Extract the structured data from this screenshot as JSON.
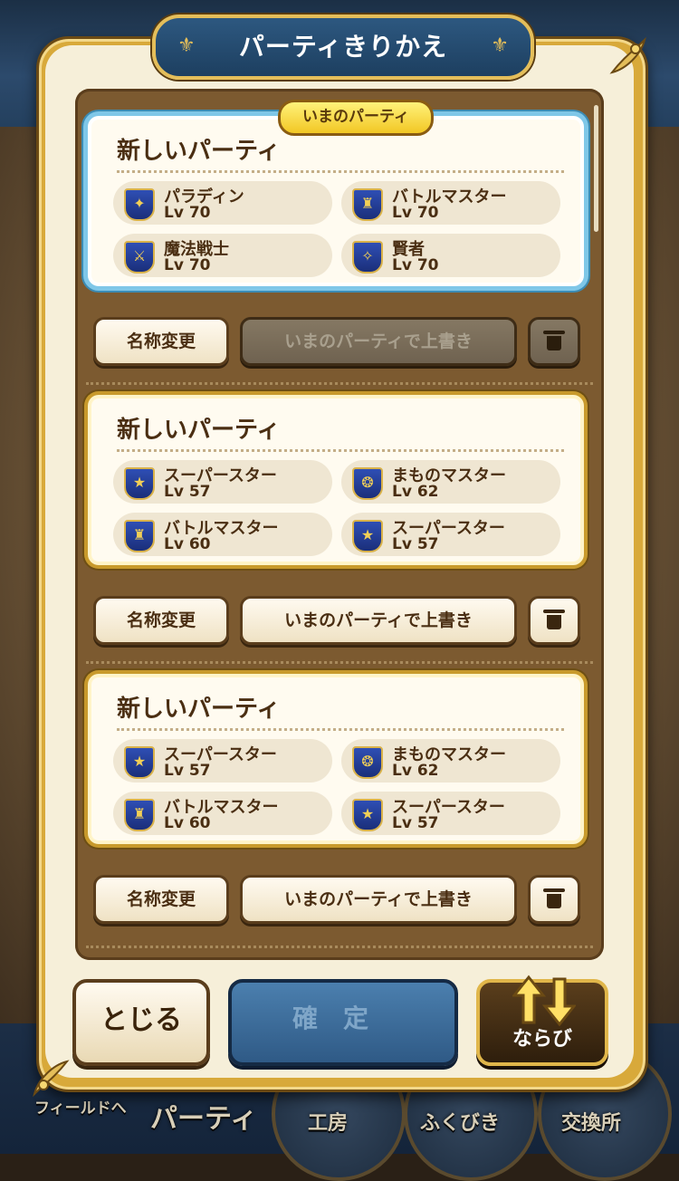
{
  "dialog": {
    "title": "パーティきりかえ",
    "current_tag": "いまのパーティ"
  },
  "parties": [
    {
      "name": "新しいパーティ",
      "is_current": true,
      "members": [
        {
          "job": "パラディン",
          "level": "Lv 70",
          "icon": "paladin-emblem"
        },
        {
          "job": "バトルマスター",
          "level": "Lv 70",
          "icon": "battle-master-emblem"
        },
        {
          "job": "魔法戦士",
          "level": "Lv 70",
          "icon": "magic-warrior-emblem"
        },
        {
          "job": "賢者",
          "level": "Lv 70",
          "icon": "sage-emblem"
        }
      ],
      "overwrite_enabled": false
    },
    {
      "name": "新しいパーティ",
      "is_current": false,
      "members": [
        {
          "job": "スーパースター",
          "level": "Lv 57",
          "icon": "superstar-emblem"
        },
        {
          "job": "まものマスター",
          "level": "Lv 62",
          "icon": "monster-master-emblem"
        },
        {
          "job": "バトルマスター",
          "level": "Lv 60",
          "icon": "battle-master-emblem"
        },
        {
          "job": "スーパースター",
          "level": "Lv 57",
          "icon": "superstar-emblem"
        }
      ],
      "overwrite_enabled": true
    },
    {
      "name": "新しいパーティ",
      "is_current": false,
      "members": [
        {
          "job": "スーパースター",
          "level": "Lv 57",
          "icon": "superstar-emblem"
        },
        {
          "job": "まものマスター",
          "level": "Lv 62",
          "icon": "monster-master-emblem"
        },
        {
          "job": "バトルマスター",
          "level": "Lv 60",
          "icon": "battle-master-emblem"
        },
        {
          "job": "スーパースター",
          "level": "Lv 57",
          "icon": "superstar-emblem"
        }
      ],
      "overwrite_enabled": true
    }
  ],
  "buttons": {
    "rename": "名称変更",
    "overwrite": "いまのパーティで上書き",
    "delete_icon": "trash-icon",
    "close": "とじる",
    "confirm": "確定",
    "sort": "ならび"
  },
  "bottom_nav": {
    "field": "フィールドへ",
    "party": "パーティ",
    "kobo": "工房",
    "fukubiki": "ふくびき",
    "koukan": "交換所"
  },
  "colors": {
    "gold_frame": "#c89a2c",
    "current_frame": "#7fc7e8",
    "confirm_disabled": "#2f5a86",
    "job_icon_blue": "#1a2f7a"
  }
}
